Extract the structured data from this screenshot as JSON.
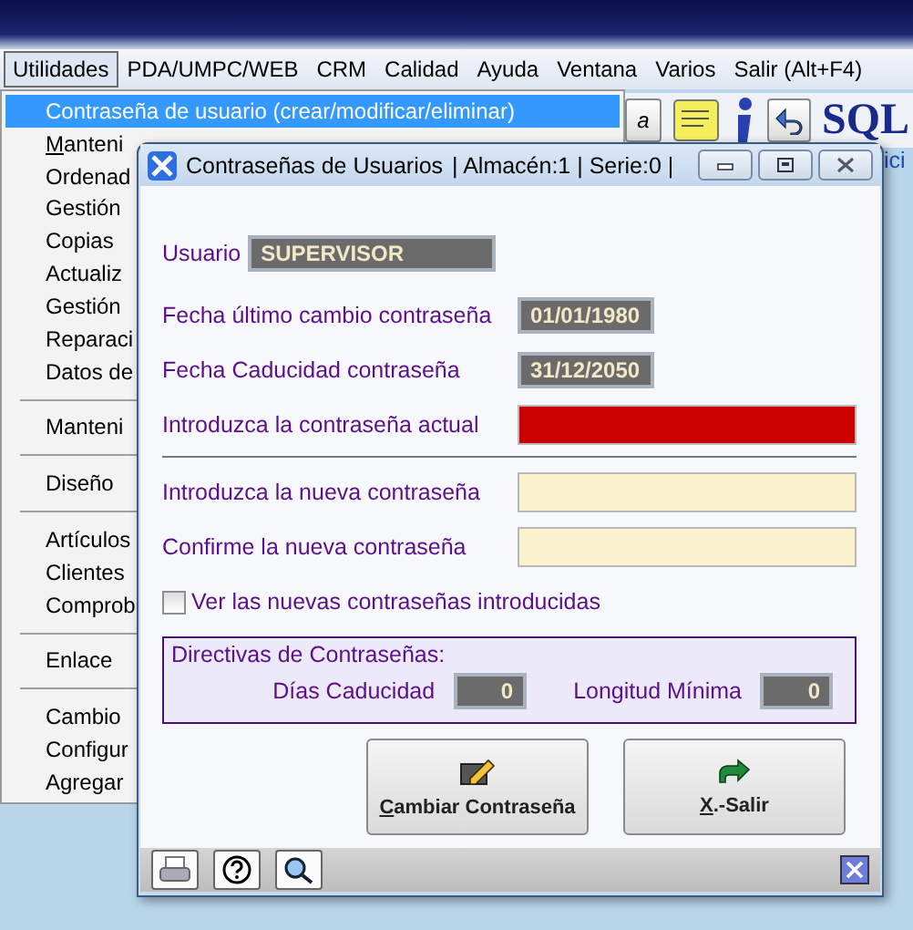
{
  "menubar": [
    {
      "label": "Utilidades",
      "selected": true
    },
    {
      "label": "PDA/UMPC/WEB",
      "selected": false
    },
    {
      "label": "CRM",
      "selected": false
    },
    {
      "label": "Calidad",
      "selected": false
    },
    {
      "label": "Ayuda",
      "selected": false
    },
    {
      "label": "Ventana",
      "selected": false
    },
    {
      "label": "Varios",
      "selected": false
    },
    {
      "label": "Salir (Alt+F4)",
      "selected": false
    }
  ],
  "menu": {
    "items": [
      {
        "kind": "item",
        "label": "Contraseña de usuario  (crear/modificar/eliminar)",
        "selected": true,
        "underline_first": false
      },
      {
        "kind": "item",
        "label": "Manteni",
        "selected": false,
        "underline_first": true
      },
      {
        "kind": "item",
        "label": "Ordenad",
        "selected": false,
        "underline_first": false
      },
      {
        "kind": "item",
        "label": "Gestión",
        "selected": false,
        "underline_first": false
      },
      {
        "kind": "item",
        "label": "Copias",
        "selected": false,
        "underline_first": false
      },
      {
        "kind": "item",
        "label": "Actualiz",
        "selected": false,
        "underline_first": false
      },
      {
        "kind": "item",
        "label": "Gestión",
        "selected": false,
        "underline_first": false
      },
      {
        "kind": "item",
        "label": "Reparaci",
        "selected": false,
        "underline_first": false
      },
      {
        "kind": "item",
        "label": "Datos de",
        "selected": false,
        "underline_first": false
      },
      {
        "kind": "separator"
      },
      {
        "kind": "item",
        "label": "Manteni",
        "selected": false,
        "underline_first": false
      },
      {
        "kind": "separator"
      },
      {
        "kind": "item",
        "label": "Diseño",
        "selected": false,
        "underline_first": false
      },
      {
        "kind": "separator"
      },
      {
        "kind": "item",
        "label": "Artículos",
        "selected": false,
        "underline_first": false
      },
      {
        "kind": "item",
        "label": "Clientes",
        "selected": false,
        "underline_first": false
      },
      {
        "kind": "item",
        "label": "Comprob",
        "selected": false,
        "underline_first": false
      },
      {
        "kind": "separator"
      },
      {
        "kind": "item",
        "label": "Enlace",
        "selected": false,
        "underline_first": false
      },
      {
        "kind": "separator"
      },
      {
        "kind": "item",
        "label": "Cambio",
        "selected": false,
        "underline_first": false
      },
      {
        "kind": "item",
        "label": "Configur",
        "selected": false,
        "underline_first": false
      },
      {
        "kind": "item",
        "label": "Agregar",
        "selected": false,
        "underline_first": false
      }
    ]
  },
  "toolbar": {
    "partial_button": "a",
    "logo": "SQL",
    "link": "ici"
  },
  "dialog": {
    "title": "Contraseñas de Usuarios",
    "context": "| Almacén:1 | Serie:0 |",
    "user": {
      "label": "Usuario",
      "value": "SUPERVISOR"
    },
    "fields": [
      {
        "kind": "display",
        "label": "Fecha último cambio contraseña",
        "value": "01/01/1980"
      },
      {
        "kind": "display",
        "label": "Fecha Caducidad contraseña",
        "value": "31/12/2050"
      },
      {
        "kind": "alert",
        "label": "Introduzca la contraseña actual"
      },
      {
        "kind": "divider"
      },
      {
        "kind": "entry",
        "label": "Introduzca la nueva contraseña"
      },
      {
        "kind": "entry",
        "label": "Confirme la nueva contraseña"
      }
    ],
    "show_passwords": {
      "label": "Ver las nuevas contraseñas introducidas",
      "checked": false
    },
    "policies": {
      "title": "Directivas de Contraseñas:",
      "items": [
        {
          "label": "Días Caducidad",
          "value": "0"
        },
        {
          "label": "Longitud Mínima",
          "value": "0"
        }
      ]
    },
    "buttons": [
      {
        "kind": "change",
        "label": "Cambiar Contraseña",
        "underline_first": true
      },
      {
        "kind": "exit",
        "label": "X.-Salir",
        "underline_first": true
      }
    ]
  }
}
